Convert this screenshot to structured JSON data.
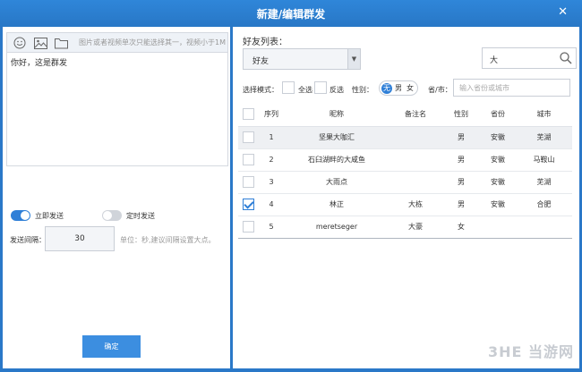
{
  "window": {
    "title": "新建/编辑群发",
    "close_glyph": "✕"
  },
  "composer": {
    "toolbar_icons": [
      "smiley-icon",
      "image-icon",
      "folder-icon"
    ],
    "hint": "图片或者视频单次只能选择其一，视频小于1M",
    "message": "你好，这是群发"
  },
  "send_options": {
    "immediate": {
      "label": "立即发送",
      "on": true
    },
    "scheduled": {
      "label": "定时发送",
      "on": false
    },
    "interval_label": "发送间隔：",
    "interval_value": "30",
    "interval_unit": "单位：秒,建议间隔设置大点。"
  },
  "confirm_label": "确定",
  "friends": {
    "label": "好友列表：",
    "group_value": "好友",
    "search_value": "大",
    "mode_label": "选择模式：",
    "select_all": "全选",
    "invert": "反选",
    "gender_label": "性别：",
    "gender_options": [
      "无",
      "男",
      "女"
    ],
    "gender_selected": 0,
    "province_label": "省/市：",
    "province_placeholder": "输入省份或城市",
    "columns": [
      "序列",
      "昵称",
      "备注名",
      "性别",
      "省份",
      "城市"
    ],
    "rows": [
      {
        "index": "1",
        "nickname": "坚果大咖汇",
        "remark": "",
        "gender": "男",
        "province": "安徽",
        "city": "芜湖",
        "checked": false,
        "highlight": true
      },
      {
        "index": "2",
        "nickname": "石臼湖畔的大咸鱼",
        "remark": "",
        "gender": "男",
        "province": "安徽",
        "city": "马鞍山",
        "checked": false,
        "highlight": false
      },
      {
        "index": "3",
        "nickname": "大雨点",
        "remark": "",
        "gender": "男",
        "province": "安徽",
        "city": "芜湖",
        "checked": false,
        "highlight": false
      },
      {
        "index": "4",
        "nickname": "林正",
        "remark": "大栋",
        "gender": "男",
        "province": "安徽",
        "city": "合肥",
        "checked": true,
        "highlight": false
      },
      {
        "index": "5",
        "nickname": "meretseger",
        "remark": "大豪",
        "gender": "女",
        "province": "",
        "city": "",
        "checked": false,
        "highlight": false
      }
    ]
  },
  "watermark": "3HE 当游网"
}
